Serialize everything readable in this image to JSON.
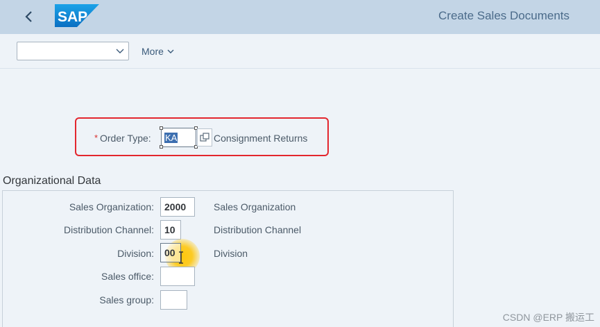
{
  "shell": {
    "title": "Create Sales Documents",
    "logo_text": "SAP",
    "back_icon": "chevron-left-icon"
  },
  "toolbar": {
    "variant_value": "",
    "more_label": "More"
  },
  "order_type": {
    "required_marker": "*",
    "label": "Order Type:",
    "value": "KA",
    "description": "Consignment Returns"
  },
  "organizational_data": {
    "title": "Organizational Data",
    "fields": [
      {
        "label": "Sales Organization:",
        "value": "2000",
        "description": "Sales Organization"
      },
      {
        "label": "Distribution Channel:",
        "value": "10",
        "description": "Distribution Channel"
      },
      {
        "label": "Division:",
        "value": "00",
        "description": "Division"
      },
      {
        "label": "Sales office:",
        "value": "",
        "description": ""
      },
      {
        "label": "Sales group:",
        "value": "",
        "description": ""
      }
    ]
  },
  "watermark": "CSDN @ERP 搬运工",
  "colors": {
    "shell_bar": "#c3d5e6",
    "background": "#eef3f8",
    "highlight_border": "#e3262e",
    "selection": "#3d6fb0",
    "cursor_highlight": "#ffc400"
  }
}
